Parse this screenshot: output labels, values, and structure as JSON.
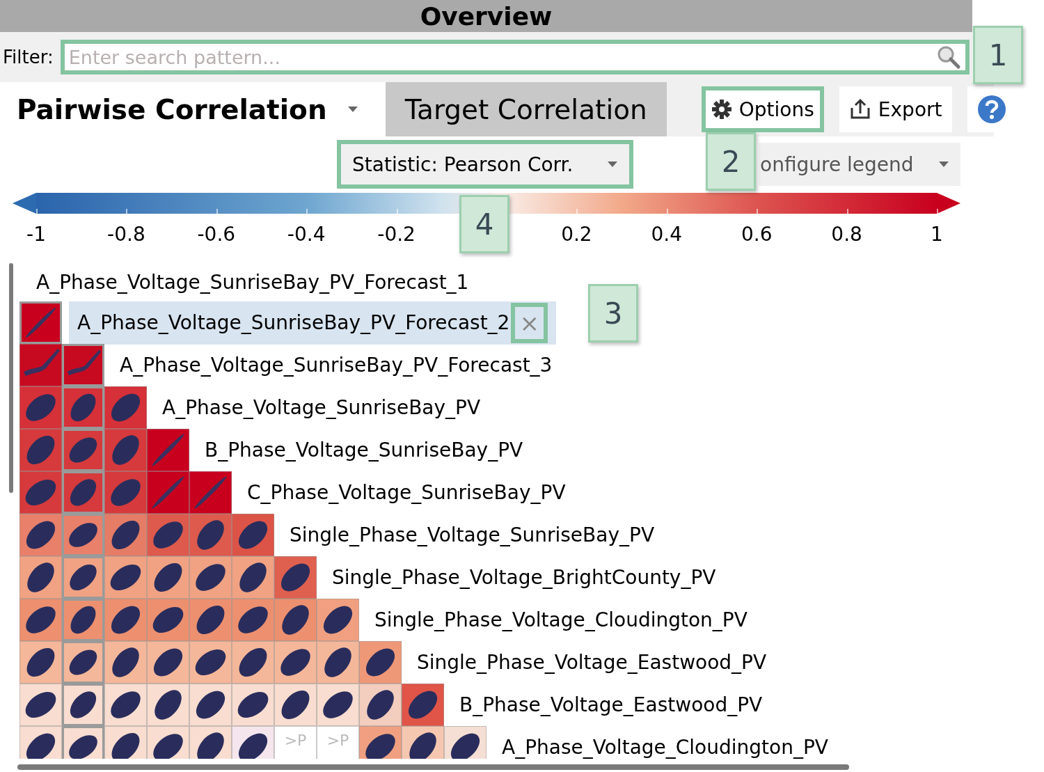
{
  "title": "Overview",
  "filter": {
    "label": "Filter:",
    "placeholder": "Enter search pattern...",
    "highlighted": true
  },
  "tabs": [
    {
      "label": "Pairwise Correlation",
      "selected": true,
      "kind": "dropdown"
    },
    {
      "label": "Target Correlation",
      "selected": false,
      "kind": "tab"
    }
  ],
  "toolbar": [
    {
      "label": "Options",
      "kind": "gear",
      "highlighted": true
    },
    {
      "label": "Export",
      "kind": "export",
      "highlighted": false
    },
    {
      "kind": "help",
      "highlighted": false
    }
  ],
  "statistic": {
    "label": "Statistic: Pearson Corr.",
    "highlighted": true
  },
  "legend_menu": {
    "label": "onfigure legend"
  },
  "legend": {
    "ticks": [
      "-1",
      "-0.8",
      "-0.6",
      "-0.4",
      "-0.2",
      "0.2",
      "0.4",
      "0.6",
      "0.8",
      "1"
    ]
  },
  "variables": [
    {
      "label": "A_Phase_Voltage_SunriseBay_PV_Forecast_1",
      "selected": false
    },
    {
      "label": "A_Phase_Voltage_SunriseBay_PV_Forecast_2",
      "selected": true,
      "close": "×",
      "close_highlighted": true,
      "cells": [
        {
          "color": "#c8001e",
          "kind": "line"
        }
      ]
    },
    {
      "label": "A_Phase_Voltage_SunriseBay_PV_Forecast_3",
      "selected": false,
      "cells": [
        {
          "color": "#c80a20",
          "kind": "wing"
        },
        {
          "color": "#c80a20",
          "kind": "wing"
        }
      ]
    },
    {
      "label": "A_Phase_Voltage_SunriseBay_PV",
      "selected": false,
      "cells": [
        {
          "color": "#d63038",
          "kind": "blob"
        },
        {
          "color": "#d63038",
          "kind": "blob"
        },
        {
          "color": "#d63038",
          "kind": "blob"
        }
      ]
    },
    {
      "label": "B_Phase_Voltage_SunriseBay_PV",
      "selected": false,
      "cells": [
        {
          "color": "#d63a3c",
          "kind": "blob"
        },
        {
          "color": "#d63a3c",
          "kind": "blob"
        },
        {
          "color": "#d63a3c",
          "kind": "blob"
        },
        {
          "color": "#c8001e",
          "kind": "line"
        }
      ]
    },
    {
      "label": "C_Phase_Voltage_SunriseBay_PV",
      "selected": false,
      "cells": [
        {
          "color": "#d63a3c",
          "kind": "blob"
        },
        {
          "color": "#d63a3c",
          "kind": "blob"
        },
        {
          "color": "#d63a3c",
          "kind": "blob"
        },
        {
          "color": "#c8001e",
          "kind": "line"
        },
        {
          "color": "#c8001e",
          "kind": "line"
        }
      ]
    },
    {
      "label": "Single_Phase_Voltage_SunriseBay_PV",
      "selected": false,
      "cells": [
        {
          "color": "#e8806a",
          "kind": "blob"
        },
        {
          "color": "#e8806a",
          "kind": "blob"
        },
        {
          "color": "#e47c66",
          "kind": "blob"
        },
        {
          "color": "#dd5a4c",
          "kind": "blob"
        },
        {
          "color": "#dd5a4c",
          "kind": "blob"
        },
        {
          "color": "#dc5448",
          "kind": "blob"
        }
      ]
    },
    {
      "label": "Single_Phase_Voltage_BrightCounty_PV",
      "selected": false,
      "cells": [
        {
          "color": "#f0a283",
          "kind": "blob"
        },
        {
          "color": "#f0a283",
          "kind": "blob"
        },
        {
          "color": "#f0a283",
          "kind": "blob"
        },
        {
          "color": "#f0a283",
          "kind": "blob"
        },
        {
          "color": "#f0a283",
          "kind": "blob"
        },
        {
          "color": "#f0a283",
          "kind": "blob"
        },
        {
          "color": "#e06050",
          "kind": "blob"
        }
      ]
    },
    {
      "label": "Single_Phase_Voltage_Cloudington_PV",
      "selected": false,
      "cells": [
        {
          "color": "#ec9070",
          "kind": "blob"
        },
        {
          "color": "#ec9070",
          "kind": "blob"
        },
        {
          "color": "#ec9070",
          "kind": "blob"
        },
        {
          "color": "#ec9070",
          "kind": "blob"
        },
        {
          "color": "#ec9070",
          "kind": "blob"
        },
        {
          "color": "#ec9070",
          "kind": "blob"
        },
        {
          "color": "#ec9070",
          "kind": "blob"
        },
        {
          "color": "#f0a080",
          "kind": "blob"
        }
      ]
    },
    {
      "label": "Single_Phase_Voltage_Eastwood_PV",
      "selected": false,
      "cells": [
        {
          "color": "#f5b79a",
          "kind": "blob"
        },
        {
          "color": "#f5b79a",
          "kind": "blob"
        },
        {
          "color": "#f5b79a",
          "kind": "blob"
        },
        {
          "color": "#f5b79a",
          "kind": "blob"
        },
        {
          "color": "#f5b79a",
          "kind": "blob"
        },
        {
          "color": "#f5b79a",
          "kind": "blob"
        },
        {
          "color": "#f5b79a",
          "kind": "blob"
        },
        {
          "color": "#f5b79a",
          "kind": "blob"
        },
        {
          "color": "#ee9878",
          "kind": "blob"
        }
      ]
    },
    {
      "label": "B_Phase_Voltage_Eastwood_PV",
      "selected": false,
      "cells": [
        {
          "color": "#f8ddd0",
          "kind": "blob"
        },
        {
          "color": "#f8ddd0",
          "kind": "blob"
        },
        {
          "color": "#f8ddd0",
          "kind": "blob"
        },
        {
          "color": "#f8ddd0",
          "kind": "blob"
        },
        {
          "color": "#f8ddd0",
          "kind": "blob"
        },
        {
          "color": "#f8ddd0",
          "kind": "blob"
        },
        {
          "color": "#f8ddd0",
          "kind": "blob"
        },
        {
          "color": "#f8ddd0",
          "kind": "blob"
        },
        {
          "color": "#f3cdbd",
          "kind": "blob"
        },
        {
          "color": "#e05548",
          "kind": "blob"
        }
      ]
    },
    {
      "label": "A_Phase_Voltage_Cloudington_PV",
      "selected": false,
      "cells": [
        {
          "color": "#f8ddd0",
          "kind": "blob"
        },
        {
          "color": "#f8ddd0",
          "kind": "blob"
        },
        {
          "color": "#f8ddd0",
          "kind": "blob"
        },
        {
          "color": "#f8ddd0",
          "kind": "blob"
        },
        {
          "color": "#f8ddd0",
          "kind": "blob"
        },
        {
          "color": "#f5e6ee",
          "kind": "blob"
        },
        {
          "color": "#ffffff",
          "kind": "text",
          "text": ">P"
        },
        {
          "color": "#ffffff",
          "kind": "text",
          "text": ">P"
        },
        {
          "color": "#f0a080",
          "kind": "blob"
        },
        {
          "color": "#f6c7b0",
          "kind": "blob"
        },
        {
          "color": "#f5dfd4",
          "kind": "blob"
        }
      ]
    }
  ],
  "callouts": [
    "1",
    "2",
    "3",
    "4"
  ]
}
